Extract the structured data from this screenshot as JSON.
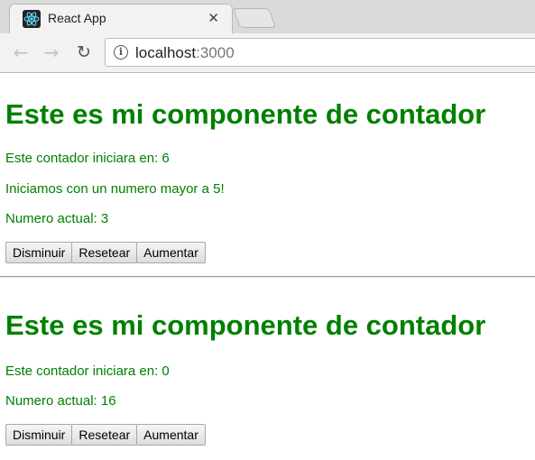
{
  "browser": {
    "tab_title": "React App",
    "tab_close": "✕",
    "url_host": "localhost",
    "url_port": ":3000",
    "back_glyph": "←",
    "forward_glyph": "→",
    "reload_glyph": "↻"
  },
  "counters": [
    {
      "heading": "Este es mi componente de contador",
      "initial_text": "Este contador iniciara en: 6",
      "extra_text": "Iniciamos con un numero mayor a 5!",
      "current_text": "Numero actual: 3",
      "buttons": {
        "decrease": "Disminuir",
        "reset": "Resetear",
        "increase": "Aumentar"
      }
    },
    {
      "heading": "Este es mi componente de contador",
      "initial_text": "Este contador iniciara en: 0",
      "current_text": "Numero actual: 16",
      "buttons": {
        "decrease": "Disminuir",
        "reset": "Resetear",
        "increase": "Aumentar"
      }
    }
  ],
  "colors": {
    "text_green": "#008000"
  },
  "icons": {
    "favicon": "react-icon",
    "info": "info-icon"
  }
}
